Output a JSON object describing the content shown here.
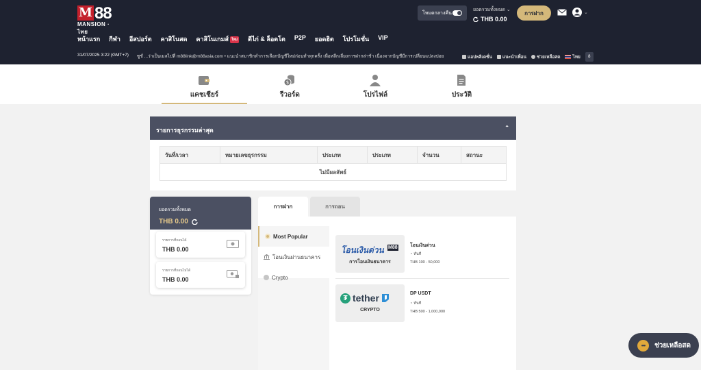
{
  "header": {
    "logo_mark": "M",
    "logo_number": "88",
    "logo_sub": "MANSION · ไทย",
    "night_mode_label": "โหมดกลางคืน",
    "balance_label": "ยอดรวมทั้งหมด",
    "balance_value": "THB 0.00",
    "deposit_button": "การฝาก"
  },
  "nav": {
    "items": [
      "หน้าแรก",
      "กีฬา",
      "อีสปอร์ต",
      "คาสิโนสด",
      "คาสิโนเกมส์",
      "ตีไก่ & ล็อตโต",
      "P2P",
      "ยอดฮิต",
      "โปรโมชั่น",
      "VIP"
    ],
    "badge": "ใหม่"
  },
  "info": {
    "datetime": "31/07/2025 3:22 (GMT+7)",
    "ticker": "ซูชั่ ...ว่าเป็นเมลไปที่ m88link@m88asia.com  •  แนะนำสมาชิกทำการเลือกบัญชีใหม่ก่อนทำทุกครั้ง เพื่อหลีกเลี่ยงการฝากล่าช้า เนื่องจากบัญชีมีการเปลี่ยนแปลงบ่อย",
    "links": [
      "แอปพลิเคชั่น",
      "แนะนำเพื่อน",
      "ช่วยเหลือสด",
      "ไทย"
    ],
    "lang_icon": "8"
  },
  "tabs": [
    "แคชเชียร์",
    "รีวอร์ด",
    "โปรไฟล์",
    "ประวัติ"
  ],
  "recent": {
    "title": "รายการธุรกรรมล่าสุด",
    "columns": [
      "วันที่/เวลา",
      "หมายเลขธุรกรรม",
      "ประเภท",
      "ประเภท",
      "จำนวน",
      "สถานะ"
    ],
    "empty": "ไม่มีผลลัพธ์"
  },
  "balance_card": {
    "total_label": "ยอดรวมทั้งหมด",
    "total_value": "THB 0.00",
    "withdrawable_label": "รายการที่ถอนได้",
    "withdrawable_value": "THB 0.00",
    "non_withdrawable_label": "รายการที่ถอนไม่ได้",
    "non_withdrawable_value": "THB 0.00"
  },
  "deposit": {
    "tab_deposit": "การฝาก",
    "tab_withdraw": "การถอน",
    "methods": [
      "Most Popular",
      "โอนเงินผ่านธนาคาร",
      "Crypto"
    ],
    "options": [
      {
        "logo_text": "โอนเงินด่วน",
        "logo_brand": "M88",
        "sub": "การโอนเงินธนาคาร",
        "title": "โอนเงินด่วน",
        "instant": "ทันที",
        "range": "THB 100 - 50,000"
      },
      {
        "logo_text": "tether",
        "sub": "CRYPTO",
        "title": "DP USDT",
        "instant": "ทันที",
        "range": "THB 500 - 1,000,000"
      }
    ]
  },
  "chat": {
    "label": "ช่วยเหลือสด",
    "icon": "•••"
  },
  "colors": {
    "header": "#1e2230",
    "accent": "#d4b87a",
    "panel": "#4b5062",
    "tether": "#26a17b"
  }
}
